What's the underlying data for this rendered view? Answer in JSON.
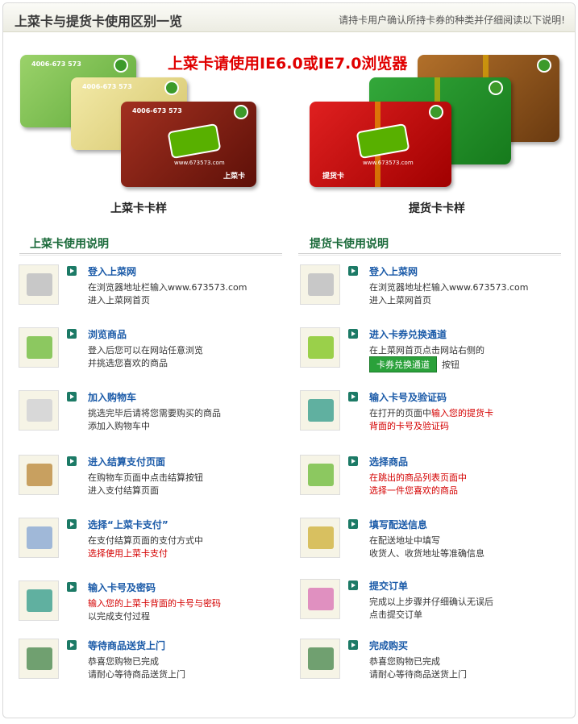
{
  "header": {
    "title": "上菜卡与提货卡使用区别一览",
    "note": "请持卡用户确认所持卡券的种类并仔细阅读以下说明!"
  },
  "browser_note": "上菜卡请使用IE6.0或IE7.0浏览器",
  "cards": {
    "phone": "4006-673 573",
    "url": "www.673573.com",
    "shangcai_label": "上菜卡",
    "tihuo_label": "提货卡"
  },
  "captions": {
    "left": "上菜卡卡样",
    "right": "提货卡卡样"
  },
  "left_section": {
    "title": "上菜卡使用说明",
    "steps": [
      {
        "title": "登入上菜网",
        "l1": "在浏览器地址栏输入www.673573.com",
        "l2": "进入上菜网首页"
      },
      {
        "title": "浏览商品",
        "l1": "登入后您可以在网站任意浏览",
        "l2": "并挑选您喜欢的商品"
      },
      {
        "title": "加入购物车",
        "l1": "挑选完毕后请将您需要购买的商品",
        "l2": "添加入购物车中"
      },
      {
        "title": "进入结算支付页面",
        "l1": "在购物车页面中点击结算按钮",
        "l2": "进入支付结算页面"
      },
      {
        "title": "选择“上菜卡支付”",
        "l1": "在支付结算页面的支付方式中",
        "l2": "选择使用上菜卡支付"
      },
      {
        "title": "输入卡号及密码",
        "l1": "输入您的上菜卡背面的卡号与密码",
        "l2": "以完成支付过程"
      },
      {
        "title": "等待商品送货上门",
        "l1": "恭喜您购物已完成",
        "l2": "请耐心等待商品送货上门"
      }
    ]
  },
  "right_section": {
    "title": "提货卡使用说明",
    "steps": [
      {
        "title": "登入上菜网",
        "l1": "在浏览器地址栏输入www.673573.com",
        "l2": "进入上菜网首页"
      },
      {
        "title": "进入卡券兑换通道",
        "l1": "在上菜网首页点击网站右侧的",
        "button": "卡券兑换通道",
        "l2": "按钮"
      },
      {
        "title": "输入卡号及验证码",
        "l1a": "在打开的页面中",
        "l1b": "输入您的提货卡",
        "l2": "背面的卡号及验证码"
      },
      {
        "title": "选择商品",
        "l1": "在跳出的商品列表页面中",
        "l2": "选择一件您喜欢的商品"
      },
      {
        "title": "填写配送信息",
        "l1": "在配送地址中填写",
        "l2": "收货人、收货地址等准确信息"
      },
      {
        "title": "提交订单",
        "l1": "完成以上步骤并仔细确认无误后",
        "l2": "点击提交订单"
      },
      {
        "title": "完成购买",
        "l1": "恭喜您购物已完成",
        "l2": "请耐心等待商品送货上门"
      }
    ]
  }
}
